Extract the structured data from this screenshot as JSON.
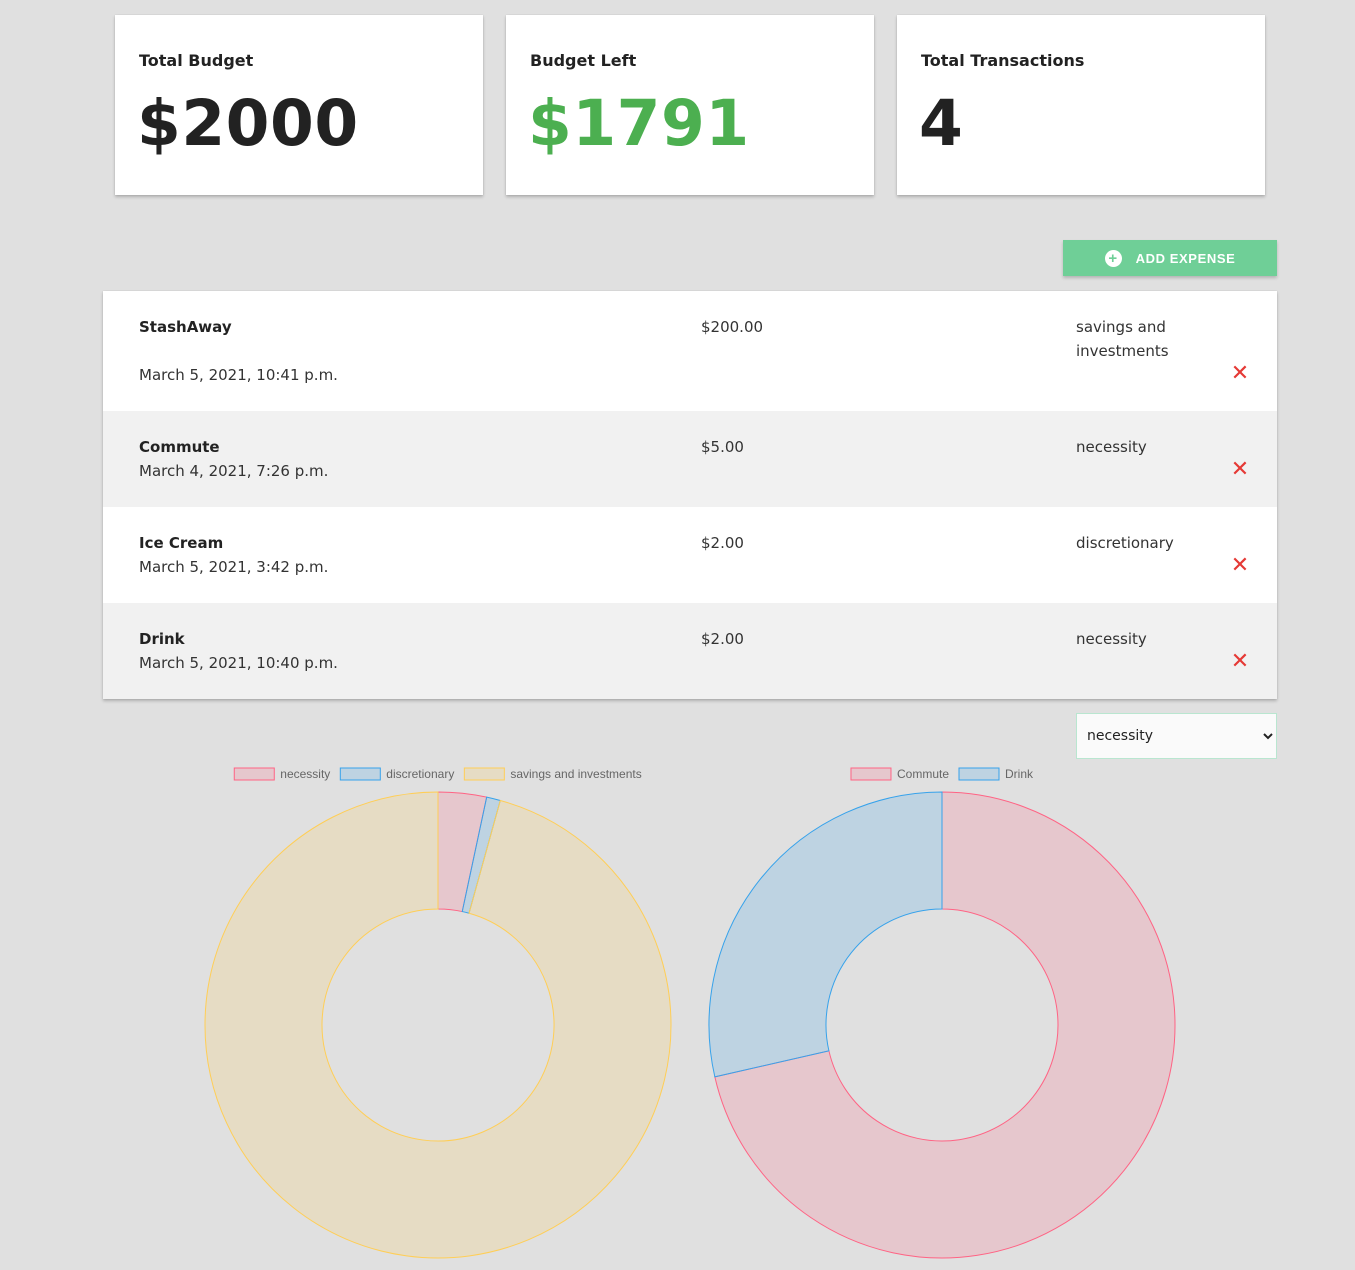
{
  "summary": {
    "total_budget": {
      "label": "Total Budget",
      "value": "$2000",
      "color": "#222222"
    },
    "budget_left": {
      "label": "Budget Left",
      "value": "$1791",
      "color": "#4caf50"
    },
    "total_transactions": {
      "label": "Total Transactions",
      "value": "4",
      "color": "#222222"
    }
  },
  "actions": {
    "add_expense_label": "ADD EXPENSE",
    "add_expense_icon": "plus-circle-icon",
    "accent": "#6fcf97"
  },
  "expenses": [
    {
      "name": "StashAway",
      "date": "March 5, 2021, 10:41 p.m.",
      "amount": "$200.00",
      "category": "savings and investments",
      "delete_icon": "close-icon"
    },
    {
      "name": "Commute",
      "date": "March 4, 2021, 7:26 p.m.",
      "amount": "$5.00",
      "category": "necessity",
      "delete_icon": "close-icon"
    },
    {
      "name": "Ice Cream",
      "date": "March 5, 2021, 3:42 p.m.",
      "amount": "$2.00",
      "category": "discretionary",
      "delete_icon": "close-icon"
    },
    {
      "name": "Drink",
      "date": "March 5, 2021, 10:40 p.m.",
      "amount": "$2.00",
      "category": "necessity",
      "delete_icon": "close-icon"
    }
  ],
  "category_filter": {
    "selected": "necessity",
    "options": [
      "necessity"
    ]
  },
  "chart_data": [
    {
      "type": "pie",
      "variant": "doughnut",
      "legend_position": "top",
      "categories": [
        "necessity",
        "discretionary",
        "savings and investments"
      ],
      "values": [
        7,
        2,
        200
      ],
      "colors": [
        "#ff6384",
        "#36a2eb",
        "#ffce56"
      ]
    },
    {
      "type": "pie",
      "variant": "doughnut",
      "legend_position": "top",
      "categories": [
        "Commute",
        "Drink"
      ],
      "values": [
        5,
        2
      ],
      "colors": [
        "#ff6384",
        "#36a2eb"
      ]
    }
  ]
}
